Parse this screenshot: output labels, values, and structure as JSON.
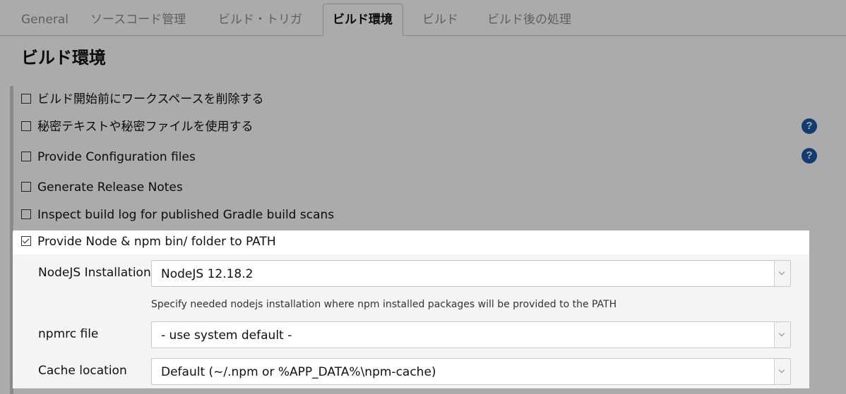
{
  "tabs": [
    {
      "label": "General",
      "active": false
    },
    {
      "label": "ソースコード管理",
      "active": false
    },
    {
      "label": "ビルド・トリガ",
      "active": false
    },
    {
      "label": "ビルド環境",
      "active": true
    },
    {
      "label": "ビルド",
      "active": false
    },
    {
      "label": "ビルド後の処理",
      "active": false
    }
  ],
  "section": {
    "title": "ビルド環境"
  },
  "options": [
    {
      "label": "ビルド開始前にワークスペースを削除する",
      "checked": false,
      "help": false
    },
    {
      "label": "秘密テキストや秘密ファイルを使用する",
      "checked": false,
      "help": true
    },
    {
      "label": "Provide Configuration files",
      "checked": false,
      "help": true
    },
    {
      "label": "Generate Release Notes",
      "checked": false,
      "help": false
    },
    {
      "label": "Inspect build log for published Gradle build scans",
      "checked": false,
      "help": false
    },
    {
      "label": "Provide Node & npm bin/ folder to PATH",
      "checked": true,
      "help": false
    }
  ],
  "help_glyph": "?",
  "node_panel": {
    "installation": {
      "label": "NodeJS Installation",
      "value": "NodeJS 12.18.2",
      "hint": "Specify needed nodejs installation where npm installed packages will be provided to the PATH"
    },
    "npmrc": {
      "label": "npmrc file",
      "value": "- use system default -"
    },
    "cache": {
      "label": "Cache location",
      "value": "Default (~/.npm or %APP_DATA%\\npm-cache)"
    }
  },
  "colors": {
    "help_icon": "#1c5aa8",
    "overlay": "rgba(0,0,0,0.33)"
  }
}
